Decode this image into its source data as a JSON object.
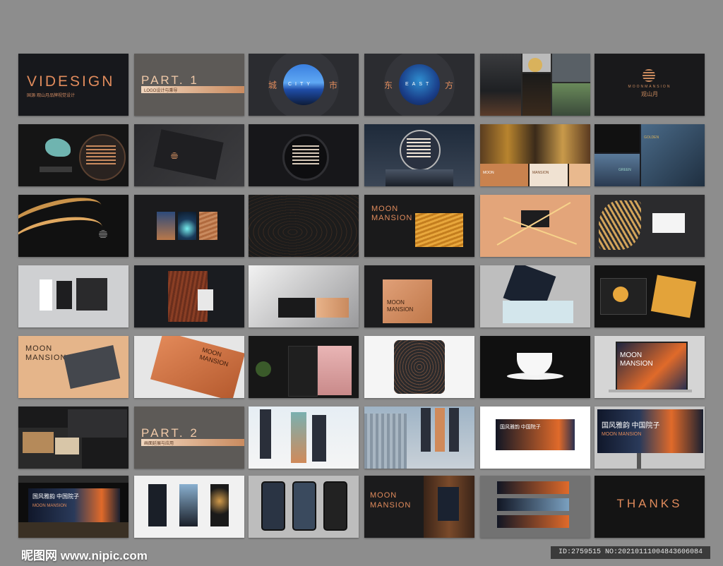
{
  "slides": {
    "videsign": {
      "title": "VIDESIGN",
      "subtitle": "国源·观山月品牌视觉设计"
    },
    "part1": {
      "title": "PART. 1",
      "subtitle": "LOGO设计与秉导"
    },
    "city": {
      "left": "城",
      "center": "CITY",
      "right": "市"
    },
    "east": {
      "left": "东",
      "center": "EAST",
      "right": "方"
    },
    "logo": {
      "en": "MOONMANSION",
      "cn": "观山月"
    },
    "moodboard": {
      "moon": "MOON",
      "mansion": "MANSION"
    },
    "golden": {
      "golden": "GOLDEN",
      "green": "GREEN"
    },
    "moon_mansion_pkg": {
      "moon": "MOON",
      "mansion": "MANSION"
    },
    "moon_mansion_envelope": {
      "moon": "MOON",
      "mansion": "MANSION"
    },
    "moon_mansion_card": {
      "moon": "MOON",
      "mansion": "MANSION"
    },
    "moon_mansion_laptop": {
      "moon": "MOON",
      "mansion": "MANSION"
    },
    "part2": {
      "title": "PART. 2",
      "subtitle": "画面延展与应用"
    },
    "billboard": {
      "headline": "国风雅韵 中国院子",
      "sub": "MOON MANSION"
    },
    "lobby": {
      "headline": "国风雅韵 中国院子",
      "sub": "MOON MANSION"
    },
    "elevator": {
      "moon": "MOON",
      "mansion": "MANSION"
    },
    "thanks": {
      "title": "THANKS"
    }
  },
  "footer": {
    "watermark": "昵图网 www.nipic.com",
    "id_text": "ID:2759515 NO:20210111004843606084"
  },
  "colors": {
    "accent": "#e08b5c",
    "dark": "#1b1b1d",
    "copper": "#c98a5e"
  }
}
